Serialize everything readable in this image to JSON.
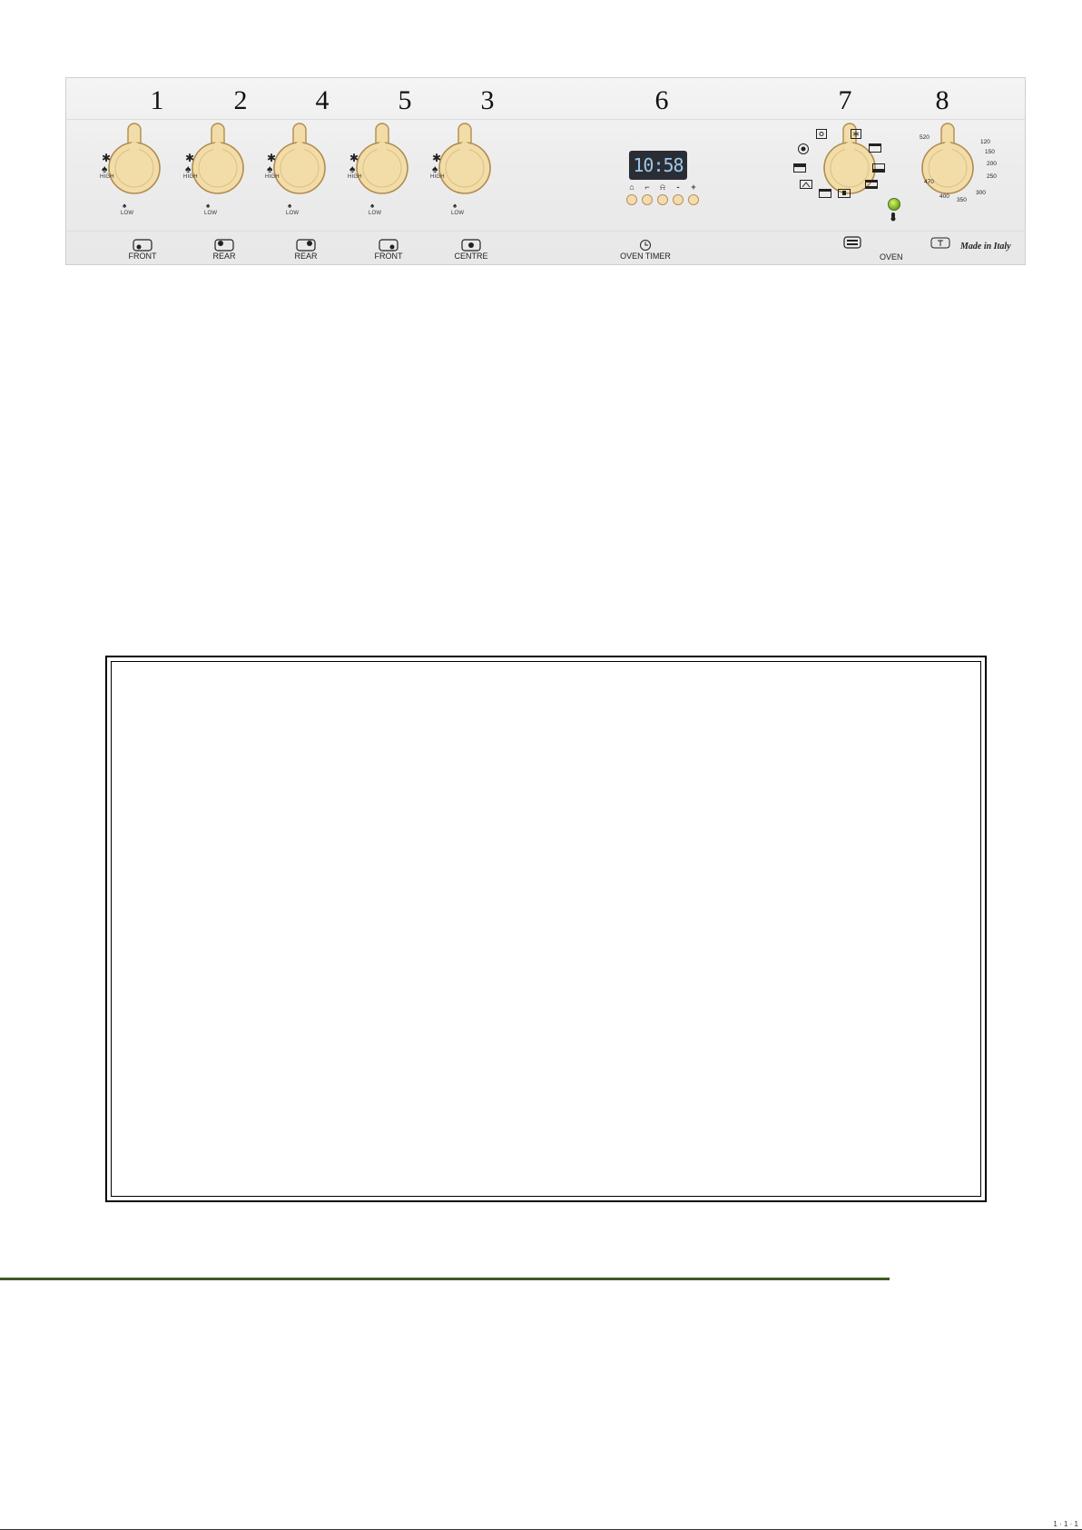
{
  "panel": {
    "burners": [
      {
        "number": "1",
        "high": "HIGH",
        "low": "LOW",
        "position": "FRONT"
      },
      {
        "number": "2",
        "high": "HIGH",
        "low": "LOW",
        "position": "REAR"
      },
      {
        "number": "4",
        "high": "HIGH",
        "low": "LOW",
        "position": "REAR"
      },
      {
        "number": "5",
        "high": "HIGH",
        "low": "LOW",
        "position": "FRONT"
      },
      {
        "number": "3",
        "high": "HIGH",
        "low": "LOW",
        "position": "CENTRE"
      }
    ],
    "timer": {
      "number": "6",
      "display": "10:58",
      "buttons": [
        "⌂",
        "⌐",
        "⍾",
        "-",
        "+"
      ],
      "label": "OVEN  TIMER"
    },
    "function_knob": {
      "number": "7"
    },
    "thermostat_knob": {
      "number": "8",
      "temperatures": [
        "120",
        "150",
        "200",
        "250",
        "300",
        "350",
        "400",
        "470",
        "520"
      ]
    },
    "oven_label": "OVEN",
    "made_in": "Made in Italy",
    "colors": {
      "knob": "#f2dca8",
      "knob_rim": "#b08c4f",
      "lamp": "#8cc43a",
      "rule": "#3f5a24"
    }
  },
  "footer": {
    "page_ref": "1 · 1 · 1"
  }
}
